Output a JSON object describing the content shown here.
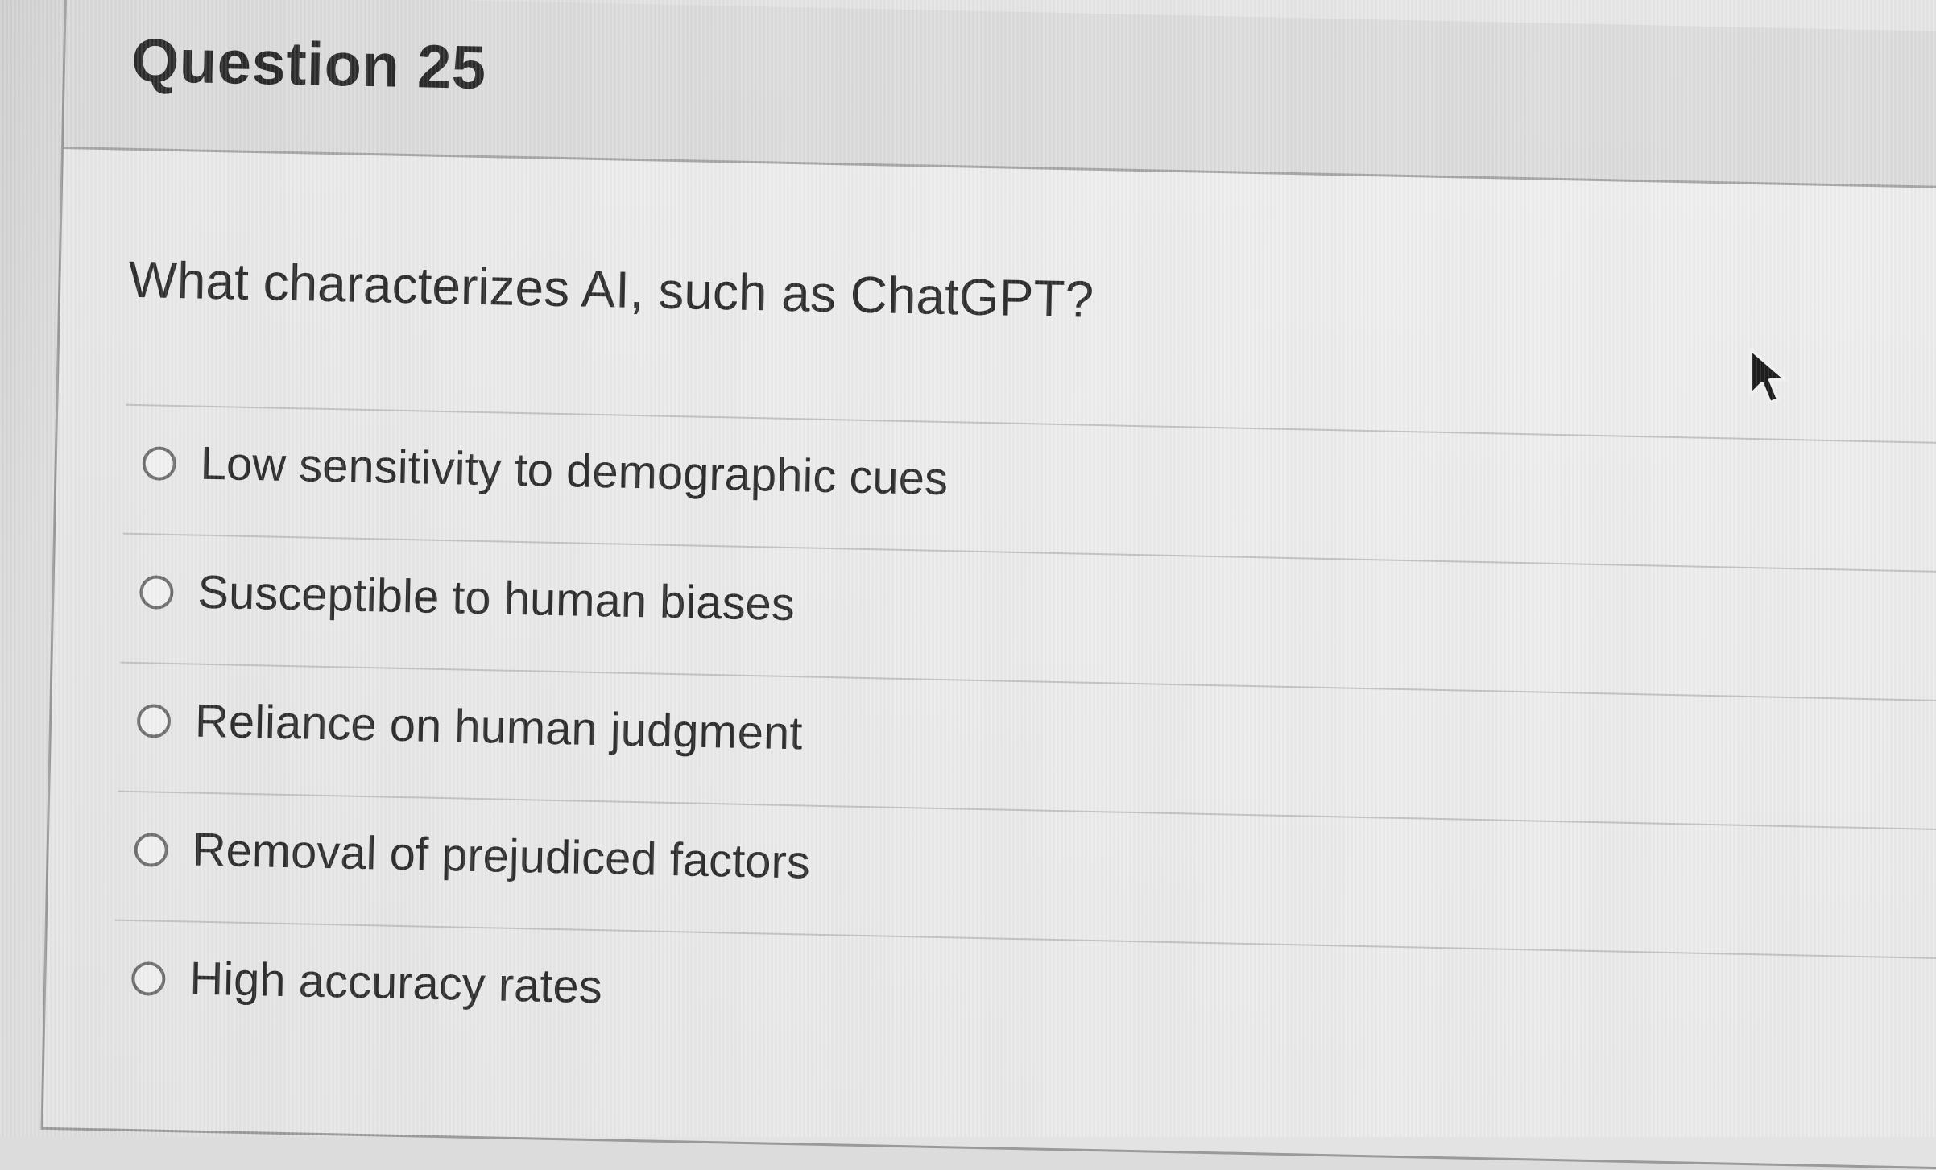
{
  "question": {
    "title": "Question 25",
    "prompt": "What characterizes AI, such as ChatGPT?",
    "options": [
      {
        "label": "Low sensitivity to demographic cues"
      },
      {
        "label": "Susceptible to human biases"
      },
      {
        "label": "Reliance on human judgment"
      },
      {
        "label": "Removal of prejudiced factors"
      },
      {
        "label": "High accuracy rates"
      }
    ]
  },
  "cursor": {
    "icon": "mouse-pointer-icon"
  },
  "colors": {
    "background": "#e4e4e4",
    "header": "#cdcdcd",
    "text": "#2e2e2e",
    "divider": "#c2c2c2"
  }
}
